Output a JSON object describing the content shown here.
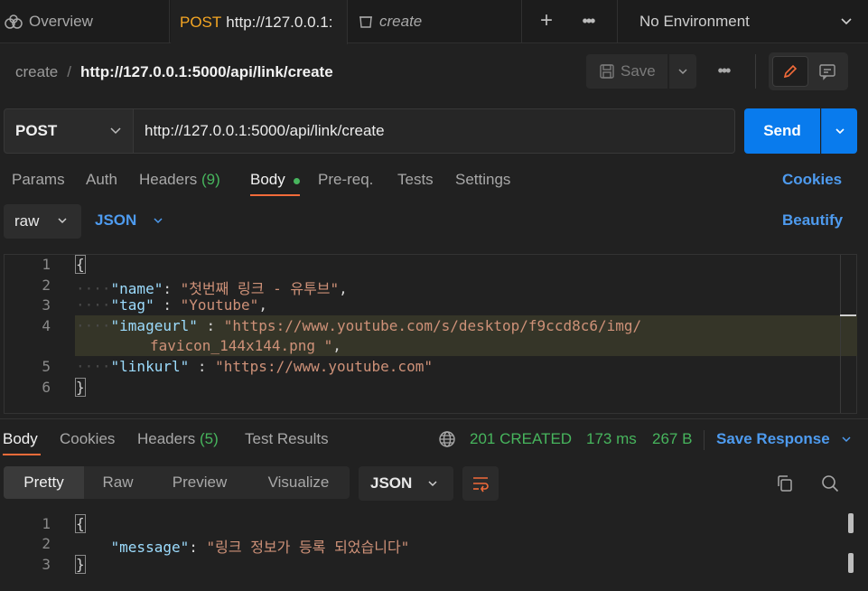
{
  "tabs": {
    "overview": "Overview",
    "active_method": "POST",
    "active_url": "http://127.0.0.1:",
    "create": "create",
    "more": "•••",
    "plus": "+"
  },
  "environment": {
    "label": "No Environment"
  },
  "breadcrumb": {
    "parent": "create",
    "separator": "/",
    "current": "http://127.0.0.1:5000/api/link/create"
  },
  "toolbar": {
    "save_label": "Save",
    "more": "•••"
  },
  "request": {
    "method": "POST",
    "url": "http://127.0.0.1:5000/api/link/create",
    "send_label": "Send"
  },
  "request_tabs": {
    "params": "Params",
    "auth": "Auth",
    "headers": "Headers",
    "headers_count": "(9)",
    "body": "Body",
    "prereq": "Pre-req.",
    "tests": "Tests",
    "settings": "Settings",
    "cookies": "Cookies"
  },
  "body_options": {
    "mode": "raw",
    "language": "JSON",
    "beautify": "Beautify"
  },
  "request_body": {
    "line_numbers": [
      "1",
      "2",
      "3",
      "4",
      "5",
      "6"
    ],
    "open_brace": "{",
    "close_brace": "}",
    "l2_key": "\"name\"",
    "l2_val": "\"첫번째 링크 - 유투브\"",
    "l3_key": "\"tag\"",
    "l3_val": "\"Youtube\"",
    "l4_key": "\"imageurl\"",
    "l4_val": "\"https://www.youtube.com/s/desktop/f9ccd8c6/img/",
    "l4_val_cont": "favicon_144x144.png \"",
    "l5_key": "\"linkurl\"",
    "l5_val": "\"https://www.youtube.com\""
  },
  "response_tabs": {
    "body": "Body",
    "cookies": "Cookies",
    "headers": "Headers",
    "headers_count": "(5)",
    "test_results": "Test Results"
  },
  "response_meta": {
    "status": "201 CREATED",
    "time": "173 ms",
    "size": "267 B",
    "save_response": "Save Response"
  },
  "response_view": {
    "pretty": "Pretty",
    "raw": "Raw",
    "preview": "Preview",
    "visualize": "Visualize",
    "language": "JSON"
  },
  "response_body": {
    "line_numbers": [
      "1",
      "2",
      "3"
    ],
    "open_brace": "{",
    "close_brace": "}",
    "key": "\"message\"",
    "val": "\"링크 정보가 등록 되었습니다\""
  },
  "colors": {
    "accent_blue": "#097bed",
    "post_orange": "#f5a623",
    "success_green": "#47b55d",
    "active_underline": "#f26b3a"
  }
}
